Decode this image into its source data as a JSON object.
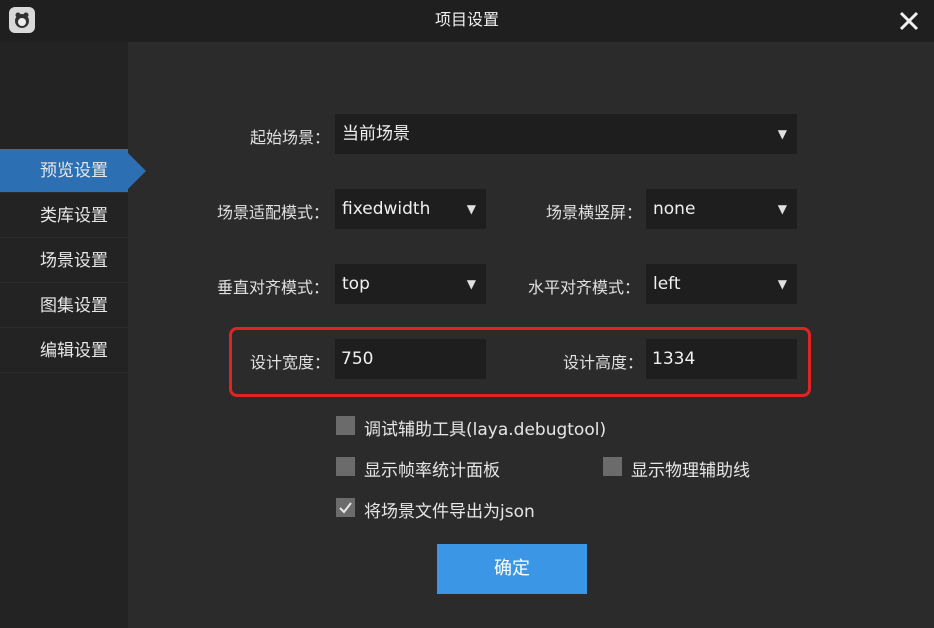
{
  "window": {
    "title": "项目设置"
  },
  "sidebar": {
    "items": [
      {
        "label": "预览设置",
        "active": true
      },
      {
        "label": "类库设置",
        "active": false
      },
      {
        "label": "场景设置",
        "active": false
      },
      {
        "label": "图集设置",
        "active": false
      },
      {
        "label": "编辑设置",
        "active": false
      }
    ]
  },
  "form": {
    "start_scene": {
      "label": "起始场景：",
      "value": "当前场景"
    },
    "scale_mode": {
      "label": "场景适配模式：",
      "value": "fixedwidth"
    },
    "screen_mode": {
      "label": "场景横竖屏：",
      "value": "none"
    },
    "valign": {
      "label": "垂直对齐模式：",
      "value": "top"
    },
    "halign": {
      "label": "水平对齐模式：",
      "value": "left"
    },
    "design_width": {
      "label": "设计宽度：",
      "value": "750"
    },
    "design_height": {
      "label": "设计高度：",
      "value": "1334"
    },
    "checkboxes": [
      {
        "label": "调试辅助工具(laya.debugtool)",
        "checked": false
      },
      {
        "label": "显示帧率统计面板",
        "checked": false
      },
      {
        "label": "显示物理辅助线",
        "checked": false
      },
      {
        "label": "将场景文件导出为json",
        "checked": true
      }
    ]
  },
  "ok_button": {
    "label": "确定"
  },
  "colors": {
    "accent": "#2d6fb3",
    "button": "#3b97e6",
    "highlight": "#e02424"
  }
}
